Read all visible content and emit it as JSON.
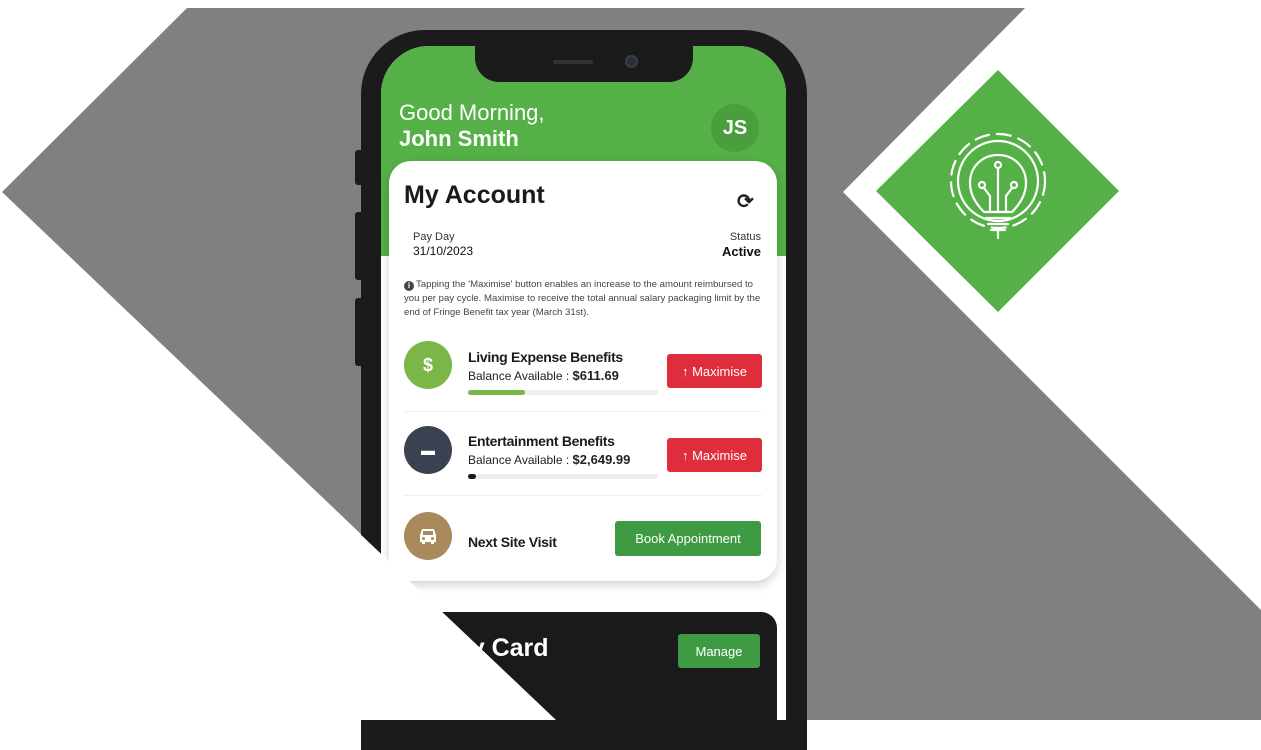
{
  "header": {
    "greeting": "Good Morning,",
    "user_name": "John Smith",
    "avatar_initials": "JS"
  },
  "account": {
    "title": "My Account",
    "pay_day_label": "Pay Day",
    "pay_day_value": "31/10/2023",
    "status_label": "Status",
    "status_value": "Active",
    "info_text": "Tapping the 'Maximise' button enables an increase to the amount reimbursed to you per pay cycle. Maximise to receive the total annual salary packaging limit by the end of Fringe Benefit tax year (March 31st)."
  },
  "benefits": [
    {
      "icon": "dollar-icon",
      "icon_glyph": "$",
      "icon_color": "#7ab648",
      "title": "Living Expense Benefits",
      "balance_label": "Balance Available : ",
      "balance_value": "$611.69",
      "progress": 0.3,
      "progress_color": "#7ab648",
      "button_label": "↑ Maximise"
    },
    {
      "icon": "credit-card-icon",
      "icon_glyph": "▬",
      "icon_color": "#3a4150",
      "title": "Entertainment Benefits",
      "balance_label": "Balance Available : ",
      "balance_value": "$2,649.99",
      "progress": 0.04,
      "progress_color": "#1a1a1a",
      "button_label": "↑ Maximise"
    }
  ],
  "site_visit": {
    "icon": "car-icon",
    "icon_color": "#a88a5c",
    "title": "Next Site Visit",
    "button_label": "Book Appointment"
  },
  "card_section": {
    "title": "iziway Card",
    "manage_label": "Manage"
  },
  "colors": {
    "brand_green": "#55b047",
    "accent_red": "#e02d3c",
    "background_grey": "#808080"
  }
}
